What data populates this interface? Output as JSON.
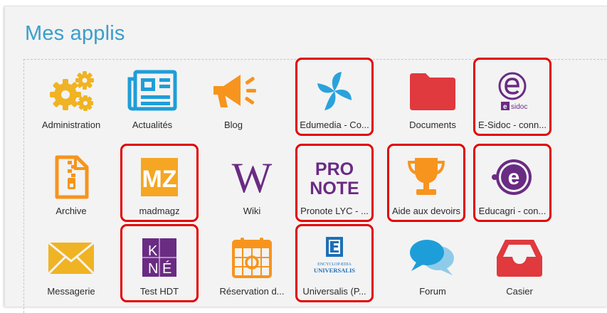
{
  "header": {
    "title": "Mes applis"
  },
  "apps": [
    {
      "label": "Administration",
      "icon": "gears-icon"
    },
    {
      "label": "Actualités",
      "icon": "newspaper-icon"
    },
    {
      "label": "Blog",
      "icon": "megaphone-icon"
    },
    {
      "label": "Edumedia - Co...",
      "icon": "edumedia-logo-icon"
    },
    {
      "label": "Documents",
      "icon": "folder-icon"
    },
    {
      "label": "E-Sidoc - conn...",
      "icon": "esidoc-logo-icon",
      "logo_text": "e-sidoc"
    },
    {
      "label": "Archive",
      "icon": "zip-file-icon"
    },
    {
      "label": "madmagz",
      "icon": "madmagz-logo-icon",
      "logo_text": "MZ"
    },
    {
      "label": "Wiki",
      "icon": "wikipedia-icon",
      "logo_text": "W"
    },
    {
      "label": "Pronote LYC - ...",
      "icon": "pronote-logo-icon",
      "logo_text": "PRO NOTE"
    },
    {
      "label": "Aide aux devoirs",
      "icon": "trophy-icon"
    },
    {
      "label": "Educagri - con...",
      "icon": "educagri-logo-icon",
      "logo_text": "e"
    },
    {
      "label": "Messagerie",
      "icon": "envelope-icon"
    },
    {
      "label": "Test HDT",
      "icon": "kne-logo-icon",
      "logo_text": "K N É"
    },
    {
      "label": "Réservation d...",
      "icon": "calendar-icon"
    },
    {
      "label": "Universalis (P...",
      "icon": "universalis-logo-icon",
      "logo_text": "ENCYCLOPÆDIA UNIVERSALIS"
    },
    {
      "label": "Forum",
      "icon": "chat-bubbles-icon"
    },
    {
      "label": "Casier",
      "icon": "inbox-tray-icon"
    }
  ],
  "colors": {
    "title": "#3a9ecb",
    "highlight": "#e30000",
    "yellow": "#f0b323",
    "orange": "#f7941d",
    "blue": "#1e9ed9",
    "red": "#e0393e",
    "purple": "#6a2b83"
  }
}
